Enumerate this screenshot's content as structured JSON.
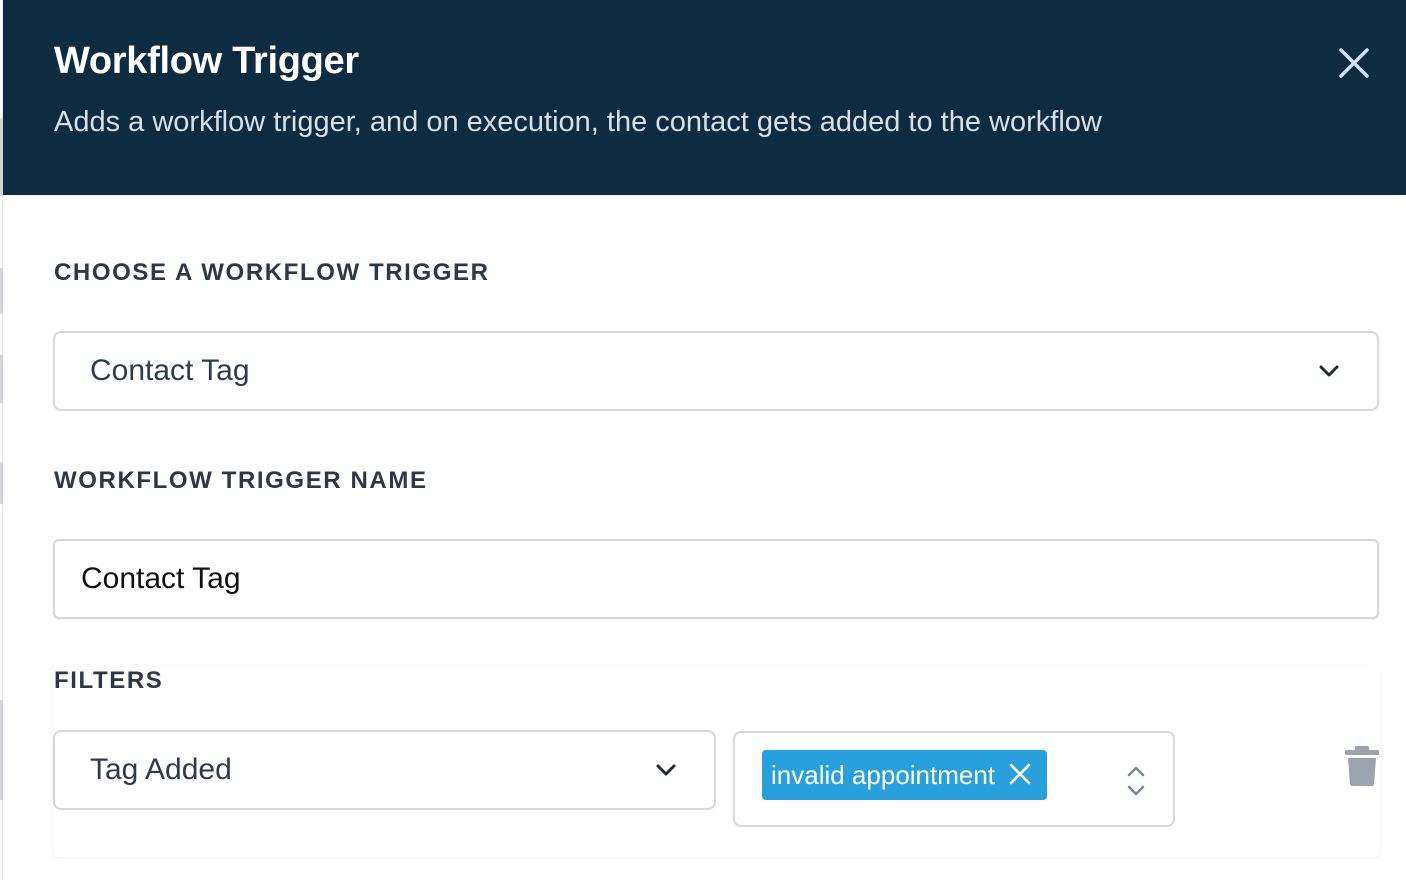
{
  "modal": {
    "title": "Workflow Trigger",
    "subtitle": "Adds a workflow trigger, and on execution, the contact gets added to the workflow",
    "close_icon": "close-icon"
  },
  "trigger_select": {
    "label": "CHOOSE A WORKFLOW TRIGGER",
    "value": "Contact Tag",
    "icon": "chevron-down-icon"
  },
  "trigger_name": {
    "label": "WORKFLOW TRIGGER NAME",
    "value": "Contact Tag"
  },
  "filters": {
    "label": "FILTERS",
    "condition": {
      "value": "Tag Added",
      "icon": "chevron-down-icon"
    },
    "tags": [
      {
        "label": "invalid appointment",
        "remove_icon": "close-icon"
      }
    ],
    "sort_icon": "up-down-chevron-icon",
    "delete_icon": "trash-icon"
  },
  "colors": {
    "header_bg": "#0d2b41",
    "tag_chip_bg": "#27a0dc",
    "label_text": "#2d3748",
    "trash_icon": "#9ca3af"
  }
}
